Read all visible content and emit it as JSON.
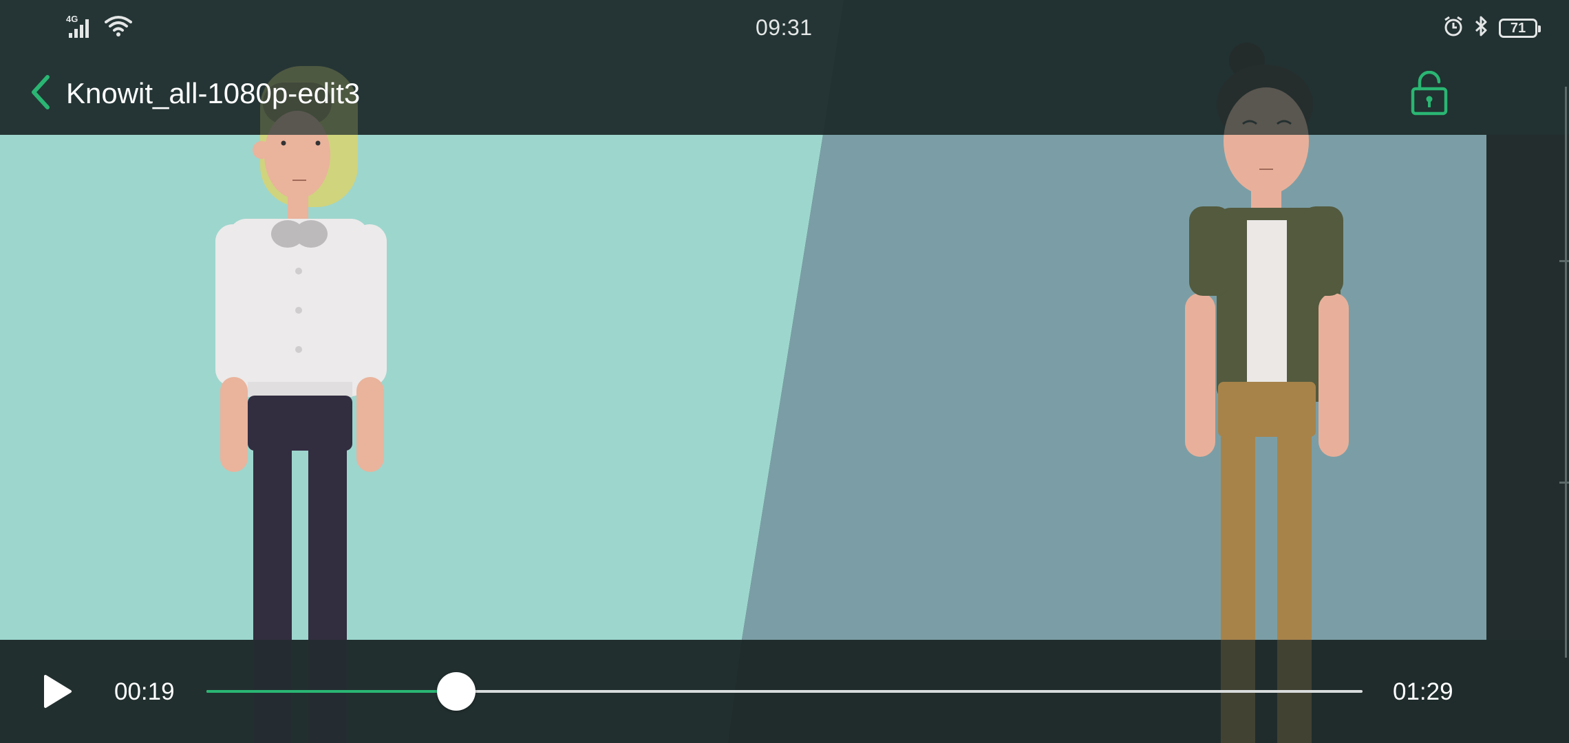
{
  "status_bar": {
    "time": "09:31",
    "network_label": "4G",
    "battery_level": "71",
    "icons": [
      "signal-icon",
      "wifi-icon",
      "alarm-icon",
      "bluetooth-icon",
      "battery-icon"
    ]
  },
  "header": {
    "title": "Knowit_all-1080p-edit3",
    "back_icon": "chevron-left-icon",
    "lock_icon": "unlock-icon"
  },
  "player": {
    "current_time": "00:19",
    "total_time": "01:29",
    "progress": 0.216,
    "play_icon": "play-icon"
  },
  "colors": {
    "accent": "#2ab673",
    "overlay": "#2a3838",
    "teal_panel": "#9dd6cd",
    "slate_panel": "#7b9ea6"
  }
}
